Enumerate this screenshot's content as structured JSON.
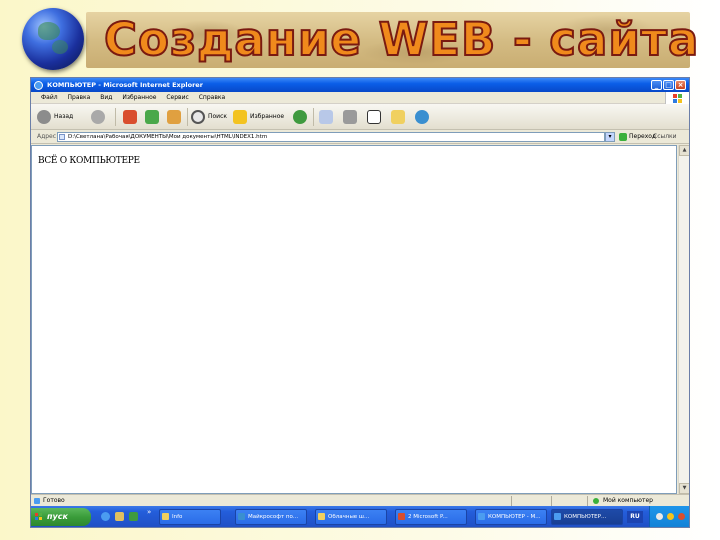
{
  "slide": {
    "title": "Создание WEB - сайта"
  },
  "window": {
    "title": "КОМПЬЮТЕР - Microsoft Internet Explorer",
    "controls": {
      "minimize": "_",
      "maximize": "□",
      "close": "×"
    }
  },
  "menu": {
    "items": [
      "Файл",
      "Правка",
      "Вид",
      "Избранное",
      "Сервис",
      "Справка"
    ]
  },
  "toolbar": {
    "back_label": "Назад",
    "search_label": "Поиск",
    "favorites_label": "Избранное"
  },
  "address": {
    "label": "Адрес",
    "value": "D:\\Светлана\\Рабочая\\ДОКУМЕНТЫ\\Мои документы\\HTML\\INDEX1.htm",
    "go_label": "Переход",
    "links_label": "Ссылки"
  },
  "page": {
    "text": "ВСЁ О КОМПЬЮТЕРЕ"
  },
  "status": {
    "left": "Готово",
    "zone": "Мой компьютер"
  },
  "taskbar": {
    "start_label": "пуск",
    "more": "»",
    "tasks": [
      "Info",
      "Майкрософт по...",
      "Облачные ш...",
      "2 Microsoft P...",
      "КОМПЬЮТЕР - M...",
      "КОМПЬЮТЕР..."
    ],
    "lang": "RU"
  },
  "colors": {
    "title_fill": "#f08a1c",
    "title_outline": "#7a1a10",
    "titlebar_blue": "#0a5ee8",
    "start_green": "#3a9c3a",
    "taskbar_blue": "#245edb"
  }
}
